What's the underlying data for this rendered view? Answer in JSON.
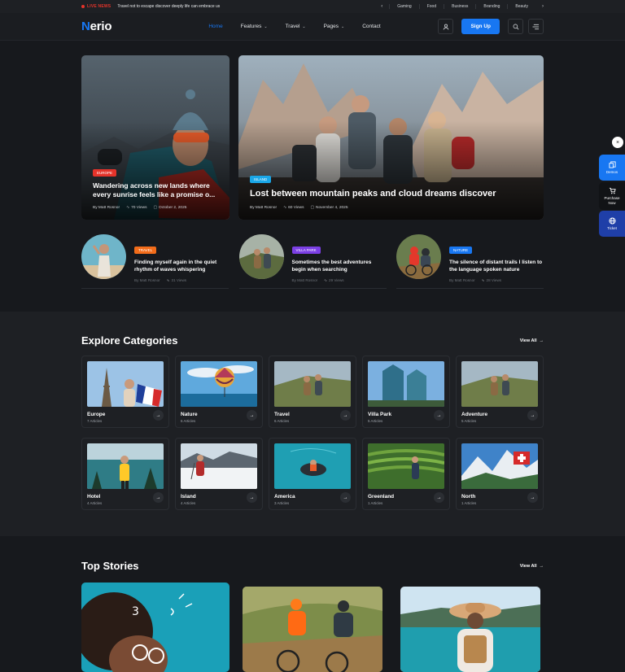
{
  "topbar": {
    "live_label": "LIVE NEWS",
    "ticker": "Travel not to escape discover deeply life can embrace us",
    "categories": [
      "Gaming",
      "Food",
      "Business",
      "Branding",
      "Beauty"
    ]
  },
  "header": {
    "logo_mark": "N",
    "logo_rest": "erio",
    "nav": [
      {
        "label": "Home",
        "active": true
      },
      {
        "label": "Features"
      },
      {
        "label": "Travel"
      },
      {
        "label": "Pages"
      },
      {
        "label": "Contact"
      }
    ],
    "signup_label": "Sign Up"
  },
  "hero": {
    "left": {
      "badge": "EUROPE",
      "badge_color": "#e5332a",
      "title": "Wandering across new lands where every sunrise feels like a promise o...",
      "author": "By Matt Rosnor",
      "views": "70 Views",
      "date": "October 2, 2025"
    },
    "right": {
      "badge": "ISLAND",
      "badge_color": "#1aa7e8",
      "title": "Lost between mountain peaks and cloud dreams discover",
      "author": "By Matt Rosnor",
      "views": "60 Views",
      "date": "November 4, 2025"
    }
  },
  "minis": [
    {
      "badge": "TRAVEL",
      "badge_color": "#f26c1a",
      "title": "Finding myself again in the quiet rhythm of waves whispering",
      "author": "By Matt Rosnor",
      "views": "31 Views"
    },
    {
      "badge": "VILLA PARK",
      "badge_color": "#7b3fe4",
      "title": "Sometimes the best adventures begin when searching",
      "author": "By Matt Rosnor",
      "views": "29 Views"
    },
    {
      "badge": "NATURE",
      "badge_color": "#1877f2",
      "title": "The silence of distant trails I listen to the language spoken nature",
      "author": "By Matt Rosnor",
      "views": "28 Views"
    }
  ],
  "explore": {
    "title": "Explore Categories",
    "view_all": "View All",
    "categories": [
      {
        "name": "Europe",
        "count": "7 Articles"
      },
      {
        "name": "Nature",
        "count": "6 Articles"
      },
      {
        "name": "Travel",
        "count": "6 Articles"
      },
      {
        "name": "Villa Park",
        "count": "5 Articles"
      },
      {
        "name": "Adventure",
        "count": "5 Articles"
      },
      {
        "name": "Hotel",
        "count": "4 Articles"
      },
      {
        "name": "Island",
        "count": "4 Articles"
      },
      {
        "name": "America",
        "count": "3 Articles"
      },
      {
        "name": "Greenland",
        "count": "1 Articles"
      },
      {
        "name": "North",
        "count": "1 Articles"
      }
    ]
  },
  "top_stories": {
    "title": "Top Stories",
    "view_all": "View All"
  },
  "side_widget": {
    "close": "×",
    "demos": "Demos",
    "purchase_line1": "Purchase",
    "purchase_line2": "Now",
    "ticket": "Ticket"
  },
  "colors": {
    "accent": "#1877f2",
    "live": "#e5332a"
  }
}
